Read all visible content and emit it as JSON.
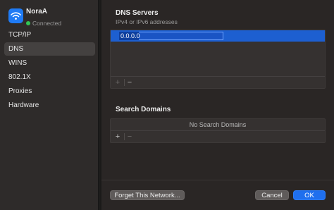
{
  "network": {
    "name": "NoraA",
    "status": "Connected",
    "status_color": "#32c554",
    "icon": "wifi-icon"
  },
  "sidebar": {
    "items": [
      {
        "label": "TCP/IP",
        "selected": false
      },
      {
        "label": "DNS",
        "selected": true
      },
      {
        "label": "WINS",
        "selected": false
      },
      {
        "label": "802.1X",
        "selected": false
      },
      {
        "label": "Proxies",
        "selected": false
      },
      {
        "label": "Hardware",
        "selected": false
      }
    ]
  },
  "dns": {
    "title": "DNS Servers",
    "subtitle": "IPv4 or IPv6 addresses",
    "entries": [
      "0.0.0.0"
    ],
    "add_label": "+",
    "remove_label": "−"
  },
  "search_domains": {
    "title": "Search Domains",
    "empty_text": "No Search Domains",
    "add_label": "+",
    "remove_label": "−"
  },
  "buttons": {
    "forget": "Forget This Network...",
    "cancel": "Cancel",
    "ok": "OK"
  },
  "colors": {
    "accent": "#1f6fee",
    "selection": "#1d5fd0"
  }
}
